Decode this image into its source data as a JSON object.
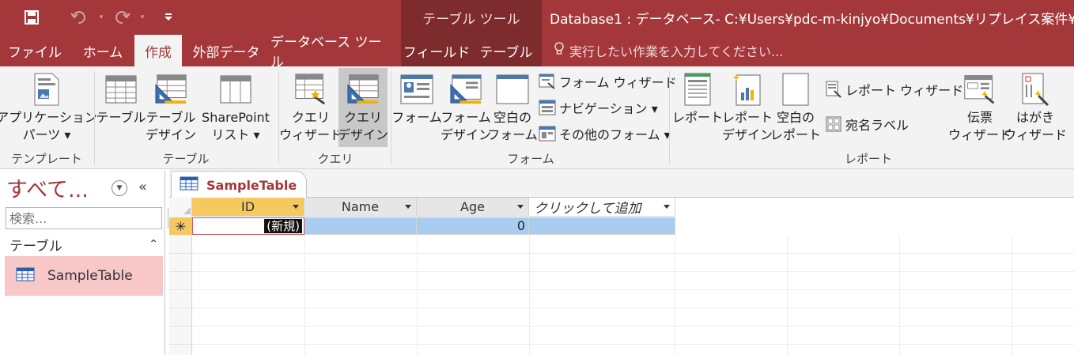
{
  "qat": {
    "save_icon": "save-icon",
    "undo_icon": "undo-icon",
    "redo_icon": "redo-icon",
    "customize_icon": "customize-qat-icon"
  },
  "context_title": "テーブル ツール",
  "window_title": "Database1 : データベース- C:¥Users¥pdc-m-kinjyo¥Documents¥リプレイス案件¥実",
  "tabs": [
    "ファイル",
    "ホーム",
    "作成",
    "外部データ",
    "データベース ツール",
    "フィールド",
    "テーブル"
  ],
  "tell_me": "実行したい作業を入力してください...",
  "ribbon": {
    "templates": {
      "label": "テンプレート",
      "app_parts": "アプリケーション\nパーツ ▾"
    },
    "tables": {
      "label": "テーブル",
      "table": "テーブル",
      "table_design": "テーブル\nデザイン",
      "sharepoint": "SharePoint\nリスト ▾"
    },
    "queries": {
      "label": "クエリ",
      "wizard": "クエリ\nウィザード",
      "design": "クエリ\nデザイン"
    },
    "forms": {
      "label": "フォーム",
      "form": "フォーム",
      "form_design": "フォーム\nデザイン",
      "blank_form": "空白の\nフォーム",
      "form_wizard": "フォーム ウィザード",
      "navigation": "ナビゲーション ▾",
      "more_forms": "その他のフォーム ▾"
    },
    "reports": {
      "label": "レポート",
      "report": "レポート",
      "report_design": "レポート\nデザイン",
      "blank_report": "空白の\nレポート",
      "report_wizard": "レポート ウィザード",
      "labels": "宛名ラベル",
      "slip_wizard": "伝票\nウィザード",
      "postcard_wizard": "はがき\nウィザード"
    }
  },
  "nav": {
    "title": "すべて...",
    "search_placeholder": "検索...",
    "section": "テーブル",
    "items": [
      "SampleTable"
    ]
  },
  "doc_tab": "SampleTable",
  "grid": {
    "columns": [
      "ID",
      "Name",
      "Age",
      "クリックして追加"
    ],
    "new_row": {
      "id": "(新規)",
      "name": "",
      "age": "0"
    },
    "row_marker": "✳"
  },
  "colors": {
    "accent": "#a4373a",
    "context": "#7e2b2d",
    "selected_header": "#f6c860",
    "row_highlight": "#a8cdf0",
    "nav_selected": "#f8c8c8"
  }
}
